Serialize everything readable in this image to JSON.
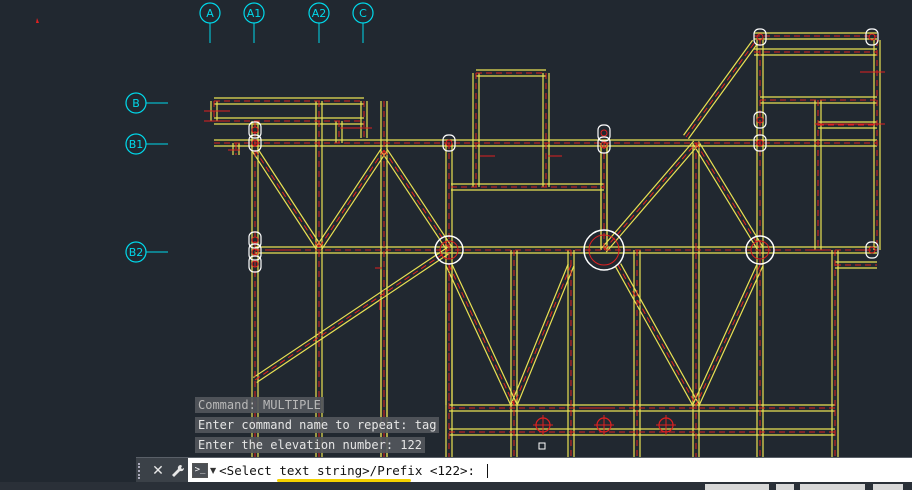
{
  "grid_labels": {
    "columns": [
      "A",
      "A1",
      "A2",
      "C"
    ],
    "rows": [
      "B",
      "B1",
      "B2"
    ]
  },
  "command_history": [
    "Command: MULTIPLE",
    "Enter command name to repeat: tag",
    "Enter the elevation number: 122"
  ],
  "command_line": {
    "prompt_icon": ">_",
    "text": "<Select text string>/Prefix <122>: "
  },
  "colors": {
    "background": "#212830",
    "frame": "#e9e253",
    "member_edge": "#ffffff",
    "hidden_line": "#e02020",
    "grid_bubble": "#00d8ea",
    "highlight": "#f3d100"
  },
  "icons": [
    "close-icon",
    "wrench-icon",
    "command-prompt-icon",
    "dropdown-arrow-icon"
  ]
}
